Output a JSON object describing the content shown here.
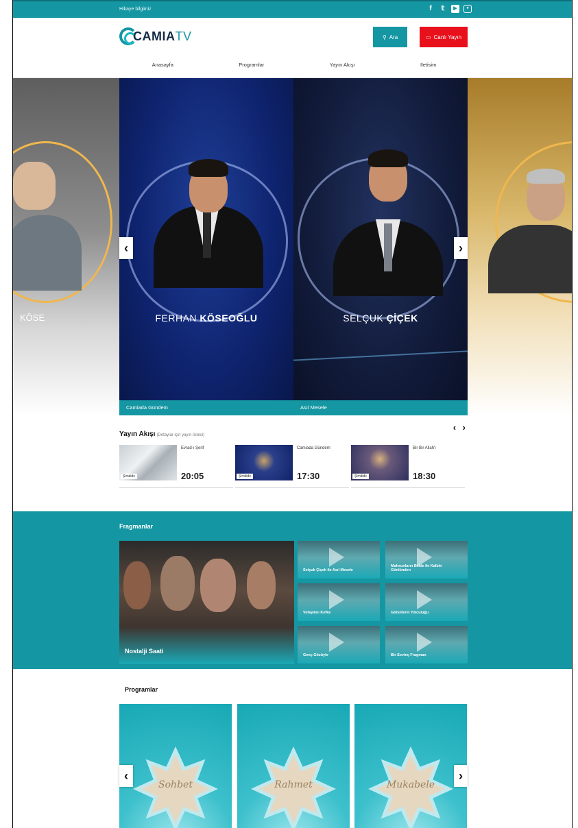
{
  "topbar": {
    "message": "Hikaye bilgimiz",
    "social": [
      "facebook-icon",
      "twitter-icon",
      "youtube-icon",
      "instagram-icon"
    ]
  },
  "header": {
    "logo_main": "CAMIA",
    "logo_tv": "TV",
    "search_label": "Ara",
    "live_label": "Canlı Yayın",
    "nav": [
      "Anasayfa",
      "Programlar",
      "Yayın Akışı",
      "Iletisim"
    ]
  },
  "slider": {
    "left_name": "KÖSE",
    "cards": [
      {
        "first": "FERHAN",
        "last": "KÖSEOĞLU",
        "caption": "Camiada Gündem"
      },
      {
        "first": "SELÇUK",
        "last": "ÇİÇEK",
        "caption": "Asıl Mesele"
      }
    ],
    "prev": "‹",
    "next": "›"
  },
  "akis": {
    "title": "Yayın Akışı",
    "subtitle": "(Detaylar için yayın listesi)",
    "arrows": "‹ ›",
    "badge": "Şimdide",
    "items": [
      {
        "name": "Evrad-ı Şerif",
        "time": "20:05"
      },
      {
        "name": "Camiada Gündem",
        "time": "17:30"
      },
      {
        "name": "Bir Bir Allah'ı",
        "time": "18:30"
      }
    ]
  },
  "fragmanlar": {
    "title": "Fragmanlar",
    "big": "Nostalji Saati",
    "items": [
      "Selçuk Çiçek ile Asıl Mesele",
      "Mahsunların Bekle ile Kalbin Gönlünden",
      "Vefayılını Kefke",
      "Gönüllerin Yolculuğu",
      "Genç Gözüyle",
      "Bir Sevinç Fragman"
    ]
  },
  "programlar": {
    "title": "Programlar",
    "items": [
      "Sohbet",
      "Rahmet",
      "Mukabele"
    ],
    "prev": "‹",
    "next": "›"
  },
  "colors": {
    "brand": "#1596a3",
    "live": "#e8101b"
  }
}
